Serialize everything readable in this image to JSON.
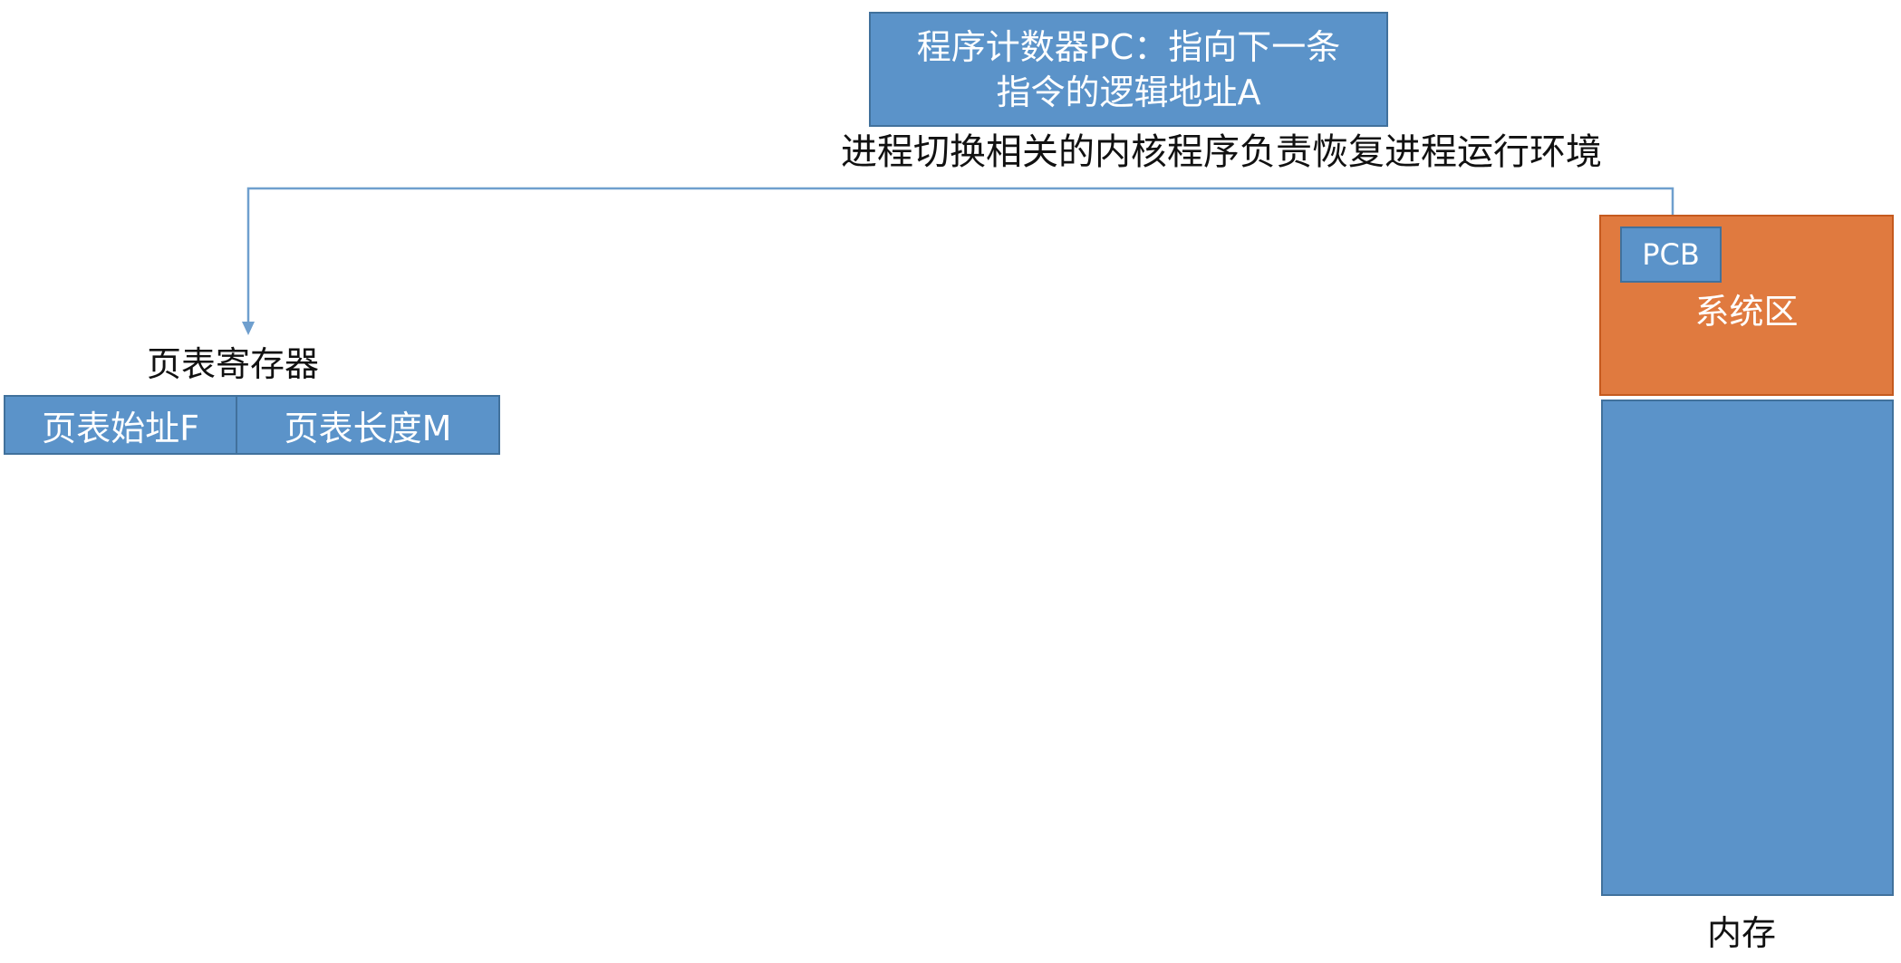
{
  "pc_register": {
    "line1": "程序计数器PC：指向下一条",
    "line2": "指令的逻辑地址A"
  },
  "kernel_note": "进程切换相关的内核程序负责恢复进程运行环境",
  "page_table_register": {
    "title": "页表寄存器",
    "start_field": "页表始址F",
    "length_field": "页表长度M"
  },
  "memory": {
    "pcb": "PCB",
    "system_area": "系统区",
    "caption": "内存"
  },
  "colors": {
    "blue_fill": "#5b93c9",
    "blue_border": "#41719c",
    "orange_fill": "#e07a3f",
    "connector": "#6f9fce"
  }
}
